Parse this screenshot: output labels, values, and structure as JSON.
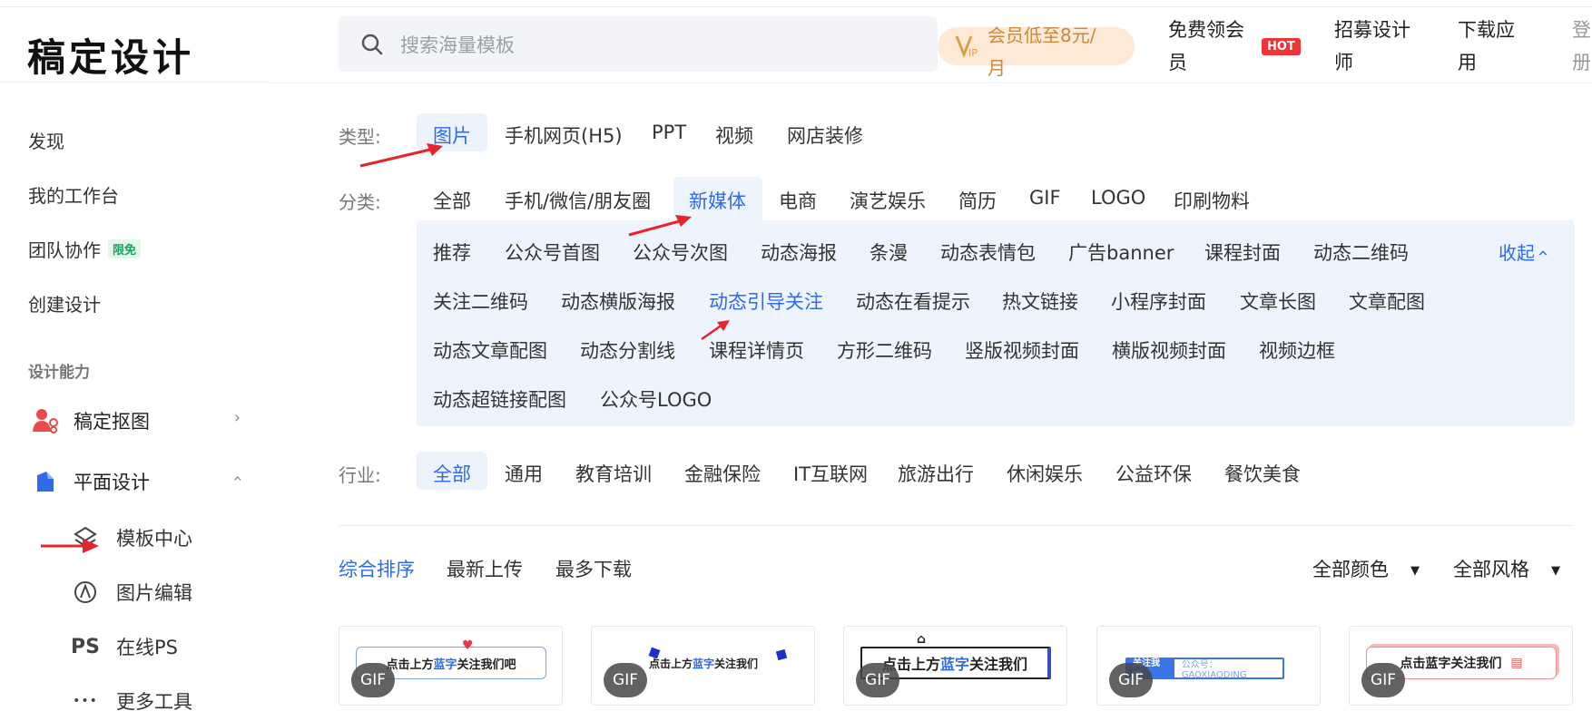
{
  "app": {
    "logo": "稿定设计"
  },
  "sidebar": {
    "nav": [
      {
        "label": "发现"
      },
      {
        "label": "我的工作台"
      },
      {
        "label": "团队协作",
        "badge": "限免"
      },
      {
        "label": "创建设计"
      }
    ],
    "section_title": "设计能力",
    "tools": [
      {
        "label": "稿定抠图",
        "icon": "cutout-icon",
        "expanded": false
      },
      {
        "label": "平面设计",
        "icon": "pen-icon",
        "expanded": true
      }
    ],
    "sub_tools": [
      {
        "label": "模板中心",
        "icon": "layers-icon"
      },
      {
        "label": "图片编辑",
        "icon": "edit-icon"
      },
      {
        "label": "在线PS",
        "icon": "ps-icon",
        "glyph": "PS"
      },
      {
        "label": "更多工具",
        "icon": "more-icon",
        "glyph": "•••"
      }
    ]
  },
  "header": {
    "search_placeholder": "搜索海量模板",
    "vip_line1": "会员低至8元/",
    "vip_line2": "月",
    "free_vip_line1": "免费领会",
    "free_vip_line2": "员",
    "hot_badge": "HOT",
    "recruit_line1": "招募设计",
    "recruit_line2": "师",
    "download_line1": "下载应",
    "download_line2": "用",
    "login_line1": "登",
    "login_line2": "册"
  },
  "filters": {
    "type_label": "类型:",
    "types": [
      "图片",
      "手机网页(H5)",
      "PPT",
      "视频",
      "网店装修"
    ],
    "category_label": "分类:",
    "categories": [
      "全部",
      "手机/微信/朋友圈",
      "新媒体",
      "电商",
      "演艺娱乐",
      "简历",
      "GIF",
      "LOGO",
      "印刷物料"
    ],
    "subcategories": [
      "推荐",
      "公众号首图",
      "公众号次图",
      "动态海报",
      "条漫",
      "动态表情包",
      "广告banner",
      "课程封面",
      "动态二维码",
      "关注二维码",
      "动态横版海报",
      "动态引导关注",
      "动态在看提示",
      "热文链接",
      "小程序封面",
      "文章长图",
      "文章配图",
      "动态文章配图",
      "动态分割线",
      "课程详情页",
      "方形二维码",
      "竖版视频封面",
      "横版视频封面",
      "视频边框",
      "动态超链接配图",
      "公众号LOGO"
    ],
    "collapse_label": "收起",
    "industry_label": "行业:",
    "industries": [
      "全部",
      "通用",
      "教育培训",
      "金融保险",
      "IT互联网",
      "旅游出行",
      "休闲娱乐",
      "公益环保",
      "餐饮美食"
    ]
  },
  "sort": {
    "options": [
      "综合排序",
      "最新上传",
      "最多下载"
    ],
    "color_filter": "全部颜色",
    "style_filter": "全部风格"
  },
  "cards": [
    {
      "badge": "GIF",
      "text_a": "点击上方",
      "text_b": "蓝字",
      "text_c": "关注我们吧"
    },
    {
      "badge": "GIF",
      "text_a": "点击上方",
      "text_b": "蓝字",
      "text_c": "关注我们"
    },
    {
      "badge": "GIF",
      "text_a": "点击上方",
      "text_b": "蓝字",
      "text_c": " 关注我们"
    },
    {
      "badge": "GIF",
      "text_a": "关注我们",
      "text_b": "",
      "text_c": "公众号：GAOXIAODING"
    },
    {
      "badge": "GIF",
      "text_a": "点击蓝字",
      "text_b": "",
      "text_c": " 关注我们"
    }
  ],
  "colors": {
    "accent": "#2f6be6",
    "panel": "#eef4fd",
    "hot": "#f0353a",
    "vip_bg": "#fde9d6",
    "vip_text": "#c98a3b",
    "annotation_arrow": "#e8232a"
  }
}
